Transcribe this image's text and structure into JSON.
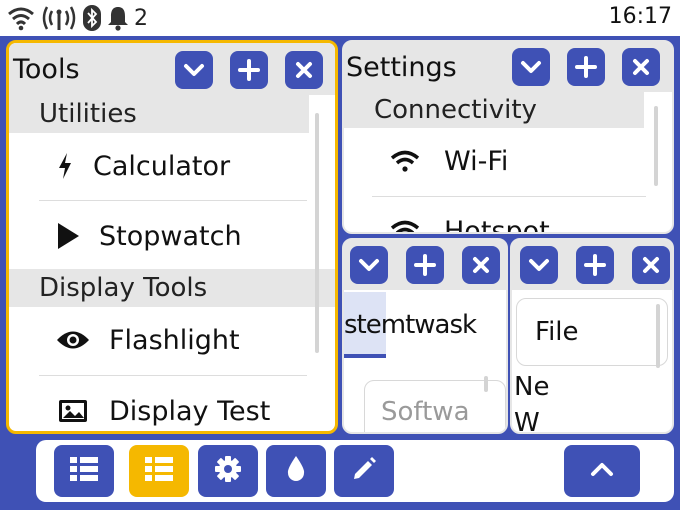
{
  "status": {
    "icons": [
      "wifi-icon",
      "signal-icon",
      "bluetooth-icon",
      "bell-icon"
    ],
    "notification_count": "2",
    "time": "16:17"
  },
  "windows": {
    "tools": {
      "title": "Tools",
      "sections": [
        {
          "label": "Utilities",
          "items": [
            {
              "label": "Calculator",
              "icon": "bolt-icon"
            },
            {
              "label": "Stopwatch",
              "icon": "play-icon"
            }
          ]
        },
        {
          "label": "Display Tools",
          "items": [
            {
              "label": "Flashlight",
              "icon": "eye-icon"
            },
            {
              "label": "Display Test",
              "icon": "image-icon"
            }
          ]
        }
      ]
    },
    "settings": {
      "title": "Settings",
      "section": "Connectivity",
      "items": [
        {
          "label": "Wi-Fi",
          "icon": "wifi-icon"
        },
        {
          "label": "Hotspot",
          "icon": "wifi-icon"
        }
      ]
    },
    "middle": {
      "tab_label": "stemtwask",
      "field_placeholder": "Softwa"
    },
    "right": {
      "field_value": "File",
      "text_line1": "Ne",
      "text_line2": "W"
    }
  },
  "window_controls": [
    "chevron-down-icon",
    "plus-icon",
    "close-icon"
  ],
  "taskbar": {
    "buttons": [
      "list-icon",
      "list-icon",
      "gear-icon",
      "drop-icon",
      "pencil-icon"
    ],
    "selected_index": 1,
    "right_button": "chevron-up-icon"
  },
  "colors": {
    "background": "#3f51b5",
    "accent": "#f5b800",
    "header": "#e6e6e6"
  }
}
